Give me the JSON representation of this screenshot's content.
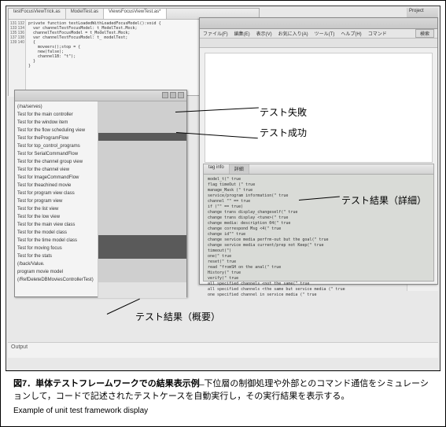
{
  "ide": {
    "tabs": [
      "testFocusViewTrick.as",
      "ModelTest.as",
      "ViewsFocusViewTest.as*"
    ],
    "active_tab": 2,
    "line_numbers": [
      "131",
      "132",
      "133",
      "134",
      "135",
      "136",
      "137",
      "138",
      "139",
      "140"
    ],
    "code": "private function testLoadedWithLoadedFocusModel():void {\n  var channelTestFocusModel: t_ModelTest.Mock;\n  channelTestFocusModel = t_ModelTest.Mock;\n  var channelTestFocusModel: t_ modelTest;\n  {\n    moveers();stop = {\n    new(false);\n    channel1B: \"t\");\n  }\n}"
  },
  "project_panel_title": "Project",
  "app": {
    "menu_items": [
      "ファイル(F)",
      "編集(E)",
      "表示(V)",
      "お気に入り(A)",
      "ツール(T)",
      "ヘルプ(H)",
      "コマンド"
    ],
    "button_label": "検索"
  },
  "detail": {
    "tabs": [
      "tag info",
      "詳細"
    ],
    "active_tab": 1,
    "lines": [
      "model_t(\" true",
      "flag timeOut (\" true",
      "manage_Mask (\" true",
      "service/program information(\" true",
      "channel \"\" == true",
      "if (\"\" == true)",
      "change trans display_changeself(\" true",
      "change trans display <tune>(\" true",
      "change media: description 04(\" true",
      "change correspond Msg  <4(\" true",
      "change id\"\" true",
      "change service media perfrm-out but the goal(\" true",
      "change service media current/prep not Keep(\" true",
      "timeout(\")",
      " one(\" true",
      " reset(\" true",
      " read \"fromSH on the anal(\" true",
      "History(\" true",
      "verify(\" true",
      "all specified channels <not the same(\" true",
      "all specified channels <the same but service media (\" true",
      "one specified channel in service media (\" true"
    ]
  },
  "tests": {
    "items": [
      "(/na/serves)",
      "Test for the main controller",
      "Test for the window item",
      "Test for the flow scheduling view",
      "Test for theProgramFlow",
      "Test for top_control_programs",
      "Test for SerialCommandFlow",
      "Test for the channel group view",
      "Test for the channel view",
      "Test for ImageCommandFlow",
      "Test for theachined movie",
      "Test for program view class",
      "Test for program view",
      "Test for the list view",
      "Test for the low view",
      "Test for the main view class",
      "Test for the model class",
      "Test for the time model class",
      "Test for moving focus",
      "Test for the stats",
      "(/back/Value.",
      "program movie model",
      "(/RefDeleteDBMoviesControllerTest)"
    ],
    "status": [
      "pass",
      "pass",
      "pass",
      "pass",
      "fail",
      "pass",
      "pass",
      "pass",
      "pass",
      "pass",
      "pass",
      "pass",
      "pass",
      "pass",
      "pass",
      "pass",
      "pass",
      "fail",
      "fail",
      "fail",
      "pass",
      "pass",
      "pass"
    ]
  },
  "output_label": "Output",
  "annotations": {
    "fail": "テスト失敗",
    "pass": "テスト成功",
    "detail": "テスト結果（詳細）",
    "summary": "テスト結果（概要）"
  },
  "caption": {
    "jp_title": "図7．単体テストフレームワークでの結果表示例",
    "jp_body": " ̶ 下位層の制御処理や外部とのコマンド通信をシミュレーションして，コードで記述されたテストケースを自動実行し，その実行結果を表示する。",
    "en": "Example of unit test framework display"
  }
}
